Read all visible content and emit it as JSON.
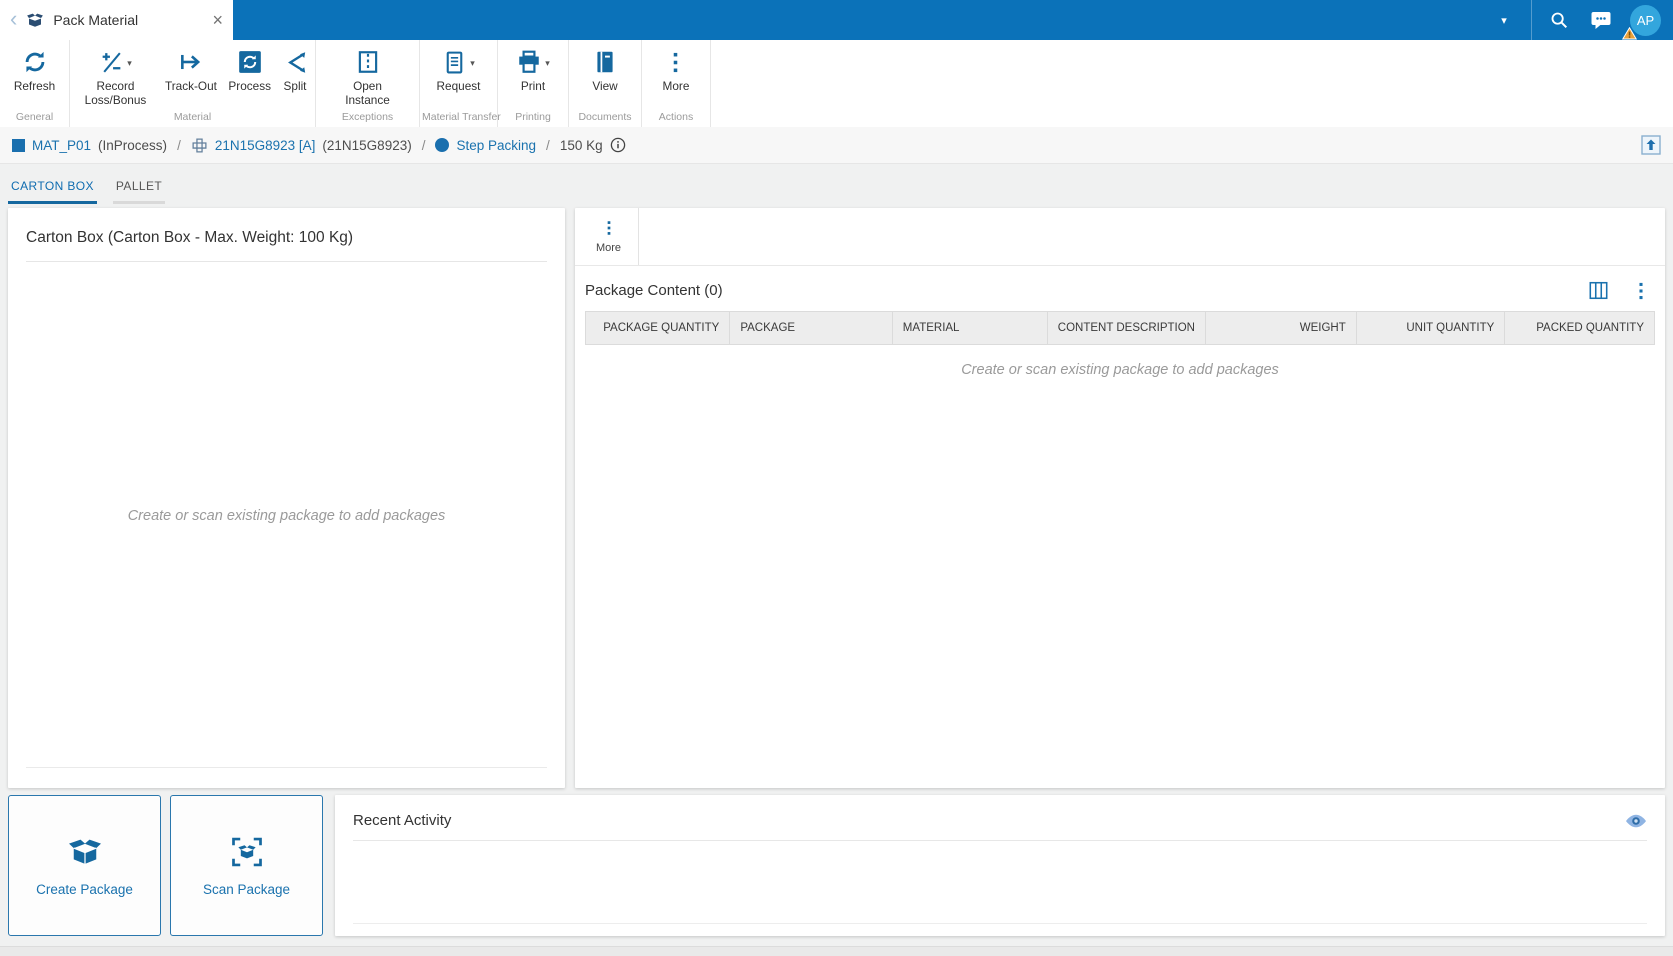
{
  "glyphs": {
    "back": "‹",
    "close": "×",
    "caret_down": "▾",
    "separator": "/"
  },
  "topbar": {
    "tab_title": "Pack Material",
    "avatar_initials": "AP"
  },
  "ribbon": {
    "groups": [
      {
        "label": "General",
        "buttons": [
          {
            "label": "Refresh",
            "icon": "refresh-icon"
          }
        ]
      },
      {
        "label": "Material",
        "buttons": [
          {
            "label": "Record Loss/Bonus",
            "icon": "record-loss-bonus-icon"
          },
          {
            "label": "Track-Out",
            "icon": "track-out-icon"
          },
          {
            "label": "Process",
            "icon": "process-icon"
          },
          {
            "label": "Split",
            "icon": "split-icon"
          }
        ]
      },
      {
        "label": "Exceptions",
        "buttons": [
          {
            "label": "Open Instance",
            "icon": "open-instance-icon"
          }
        ]
      },
      {
        "label": "Material Transfer",
        "buttons": [
          {
            "label": "Request",
            "icon": "request-icon"
          }
        ]
      },
      {
        "label": "Printing",
        "buttons": [
          {
            "label": "Print",
            "icon": "print-icon"
          }
        ]
      },
      {
        "label": "Documents",
        "buttons": [
          {
            "label": "View",
            "icon": "view-icon"
          }
        ]
      },
      {
        "label": "Actions",
        "buttons": [
          {
            "label": "More",
            "icon": "more-dots-icon"
          }
        ]
      }
    ]
  },
  "breadcrumb": {
    "material": "MAT_P01",
    "material_state": "(InProcess)",
    "lot": "21N15G8923 [A]",
    "lot_alt": "(21N15G8923)",
    "step": "Step Packing",
    "quantity": "150 Kg"
  },
  "tabs": {
    "carton_box": "CARTON BOX",
    "pallet": "PALLET"
  },
  "left_panel": {
    "title": "Carton Box (Carton Box - Max. Weight: 100 Kg)",
    "empty_message": "Create or scan existing package to add packages"
  },
  "right_panel": {
    "more_label": "More",
    "table_title": "Package Content (0)",
    "columns": [
      "PACKAGE QUANTITY",
      "PACKAGE",
      "MATERIAL",
      "CONTENT DESCRIPTION",
      "WEIGHT",
      "UNIT QUANTITY",
      "PACKED QUANTITY"
    ],
    "empty_message": "Create or scan existing package to add packages"
  },
  "footer_actions": {
    "create_package": "Create Package",
    "scan_package": "Scan Package"
  },
  "recent_activity": {
    "title": "Recent Activity"
  },
  "colors": {
    "topbar": "#0b72b9",
    "accent": "#15689f",
    "link": "#1a72ae",
    "avatar": "#33a6dd",
    "warning": "#e9a13b"
  }
}
